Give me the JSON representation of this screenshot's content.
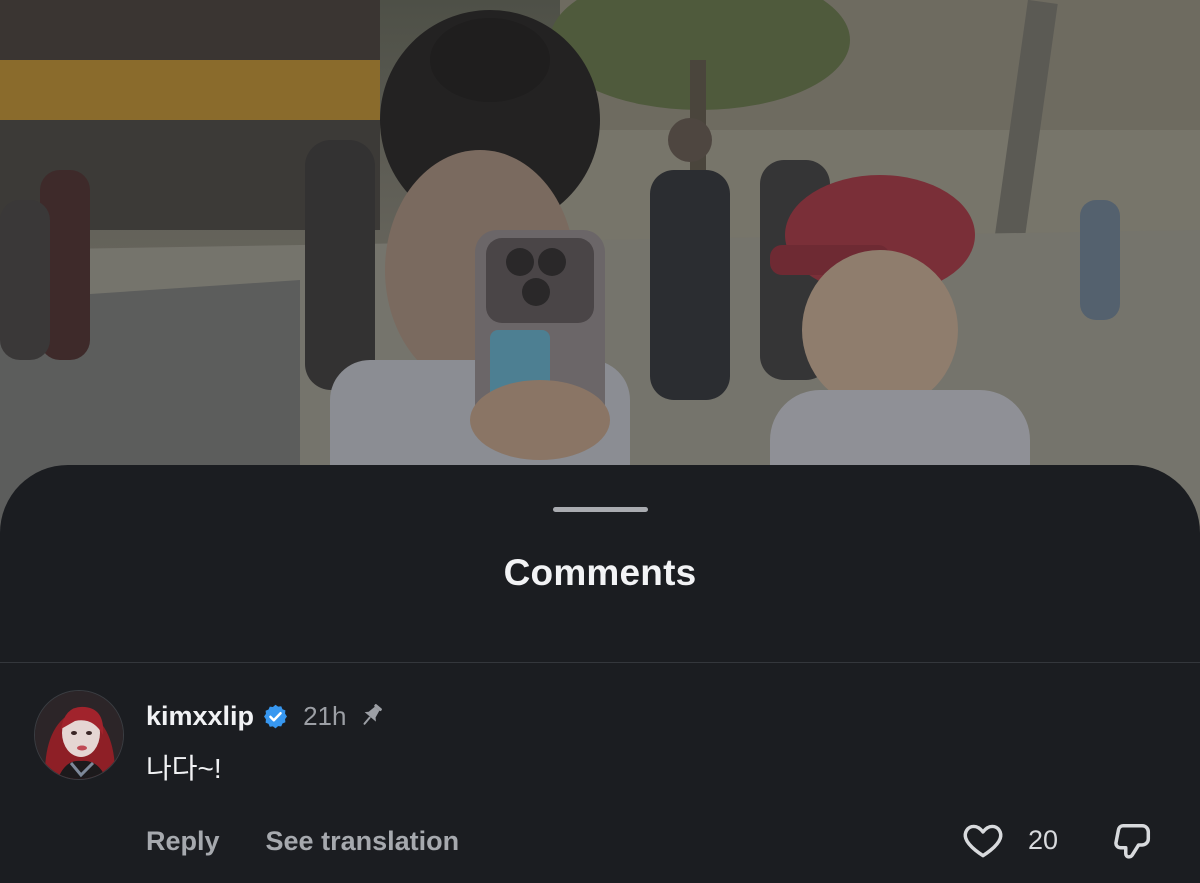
{
  "sheet": {
    "title": "Comments"
  },
  "comment": {
    "username": "kimxxlip",
    "verified": true,
    "time": "21h",
    "pinned": true,
    "text": "나다~!",
    "actions": {
      "reply_label": "Reply",
      "translate_label": "See translation"
    },
    "like_count": "20"
  },
  "icons": {
    "verified": "verified-badge-icon",
    "pin": "pin-icon",
    "like": "heart-icon",
    "dislike": "dislike-icon"
  },
  "colors": {
    "sheet_background": "#1b1d21",
    "verified_blue": "#3797f0",
    "primary_text": "#f1f2f4",
    "secondary_text": "#a6a9ae"
  }
}
